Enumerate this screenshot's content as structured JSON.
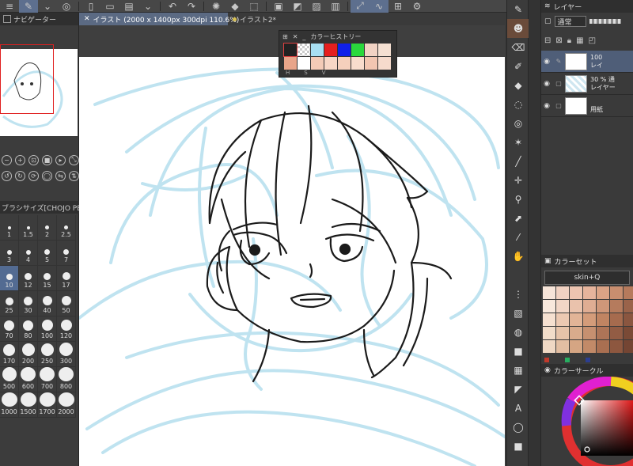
{
  "document": {
    "tabs": [
      {
        "label": "イラスト (2000 x 1400px 300dpi 110.6%)"
      },
      {
        "label": "イラスト2*"
      }
    ]
  },
  "navigator": {
    "title": "ナビゲーター"
  },
  "brush_size": {
    "title": "ブラシサイズ[CHOJO PE",
    "sizes": [
      "1",
      "1.5",
      "2",
      "2.5",
      "3",
      "4",
      "5",
      "7",
      "10",
      "12",
      "15",
      "17",
      "25",
      "30",
      "40",
      "50",
      "70",
      "80",
      "100",
      "120",
      "170",
      "200",
      "250",
      "300",
      "500",
      "600",
      "700",
      "800",
      "1000",
      "1500",
      "1700",
      "2000"
    ],
    "selected": "10"
  },
  "color_history": {
    "title": "カラーヒストリー",
    "footer": [
      "H",
      "S",
      "V"
    ],
    "swatches": [
      "#222222",
      "#dddddd",
      "#a8dff2",
      "#e51f1f",
      "#1020e8",
      "#2ad83c",
      "#f2d3c4",
      "#f5e0d2",
      "#e8a58a",
      "#ffffff",
      "#f3cbb7",
      "#f7d7c6",
      "#f5d0bc",
      "#f8dccc",
      "#f2c6b1",
      "#f6dbcc"
    ]
  },
  "layer_panel": {
    "title": "レイヤー",
    "blend_mode": "通常",
    "layers": [
      {
        "line1": "100",
        "line2": "レイ",
        "thumb": "white"
      },
      {
        "line1": "30 % 通",
        "line2": "レイヤー",
        "thumb": "blue"
      },
      {
        "line1": "",
        "line2": "用紙",
        "thumb": "white"
      }
    ]
  },
  "color_set": {
    "title": "カラーセット",
    "selected": "skin+Q",
    "swatches": [
      "#f6e4d8",
      "#f1d2c2",
      "#edc4b0",
      "#e6b49c",
      "#dba385",
      "#c98e6f",
      "#b67a5c",
      "#f8e8dc",
      "#f2d6c6",
      "#eac2ac",
      "#dfad93",
      "#cf9779",
      "#b57b5d",
      "#9a634a",
      "#f5e0d0",
      "#ecc9b2",
      "#e2b497",
      "#d49c7a",
      "#c08462",
      "#a66b4e",
      "#8a5640",
      "#f1dcc9",
      "#e6c3a9",
      "#d9ab8c",
      "#c69070",
      "#ad7457",
      "#925c44",
      "#7a4a36",
      "#efd8c4",
      "#e2bea2",
      "#d5a583",
      "#c28a68",
      "#a96f51",
      "#8d573f",
      "#744533"
    ],
    "dots": [
      "#c0392b",
      "#27ae60",
      "#2c3e90"
    ]
  },
  "color_wheel": {
    "title": "カラーサークル"
  },
  "colors": {
    "accent": "#5b6a83",
    "selected": "#536b92",
    "canvas": "#ffffff",
    "sketch": "#bfe3f0",
    "line": "#1b1b1b"
  }
}
